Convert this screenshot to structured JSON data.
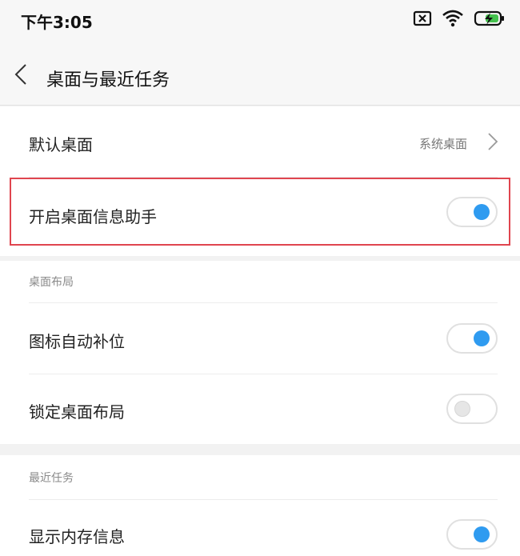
{
  "status": {
    "time": "下午3:05"
  },
  "header": {
    "title": "桌面与最近任务"
  },
  "rows": {
    "default_launcher": {
      "label": "默认桌面",
      "value": "系统桌面"
    },
    "info_assistant": {
      "label": "开启桌面信息助手",
      "enabled": true
    }
  },
  "sections": {
    "layout": {
      "title": "桌面布局",
      "items": [
        {
          "label": "图标自动补位",
          "enabled": true
        },
        {
          "label": "锁定桌面布局",
          "enabled": false
        }
      ]
    },
    "recent": {
      "title": "最近任务",
      "items": [
        {
          "label": "显示内存信息",
          "enabled": true
        }
      ]
    }
  },
  "colors": {
    "accent": "#2f9bf0",
    "highlight": "#e0454f"
  }
}
